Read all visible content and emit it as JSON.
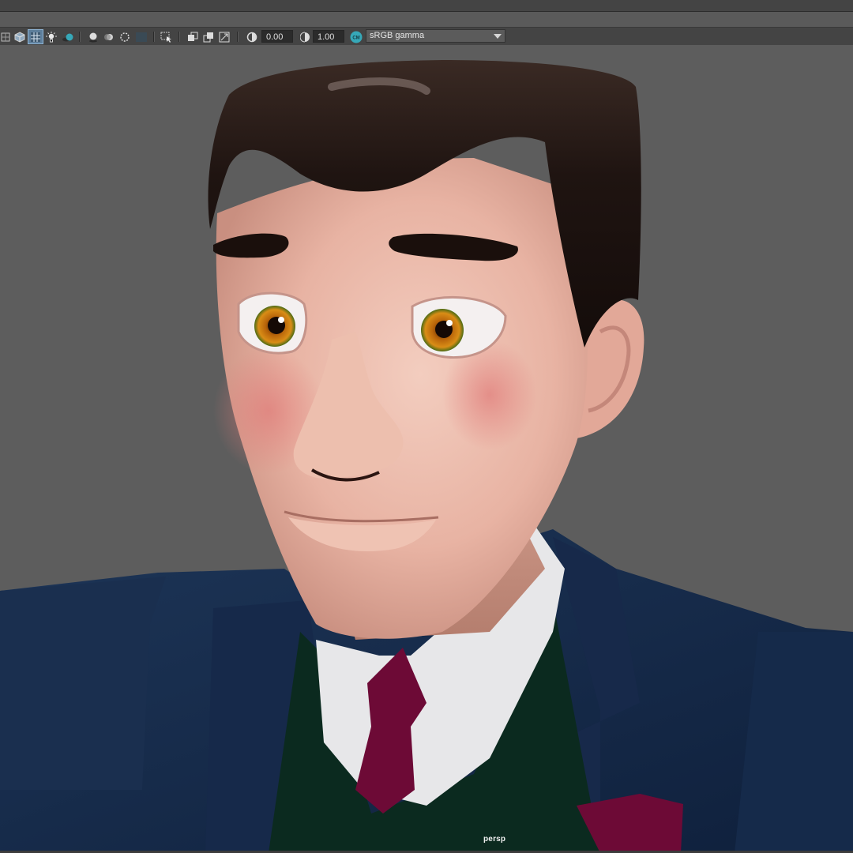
{
  "toolbar": {
    "exposure_value": "0.00",
    "gamma_value": "1.00",
    "color_management_badge": "CM",
    "color_space": "sRGB gamma"
  },
  "viewport": {
    "camera_label": "persp"
  },
  "colors": {
    "toolbar_bg": "#444444",
    "viewport_bg": "#5d5d5d",
    "active_button": "#5e7f9c",
    "accent_teal": "#36a8b8"
  }
}
